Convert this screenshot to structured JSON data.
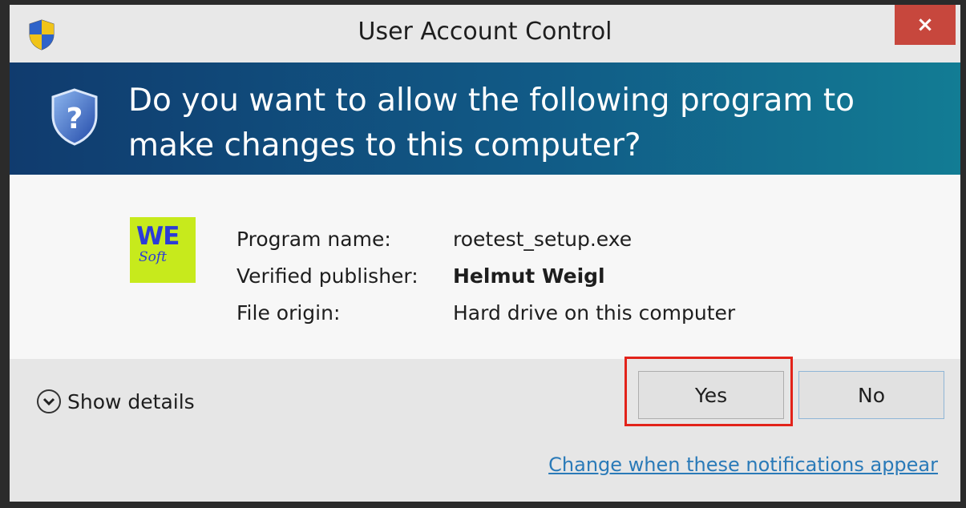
{
  "window": {
    "title": "User Account Control",
    "close_label": "×"
  },
  "banner": {
    "question": "Do you want to allow the following program to make changes to this computer?"
  },
  "app": {
    "logo_top": "WE",
    "logo_bottom": "Soft"
  },
  "info": {
    "rows": [
      {
        "label": "Program name:",
        "value": "roetest_setup.exe",
        "bold": false
      },
      {
        "label": "Verified publisher:",
        "value": "Helmut Weigl",
        "bold": true
      },
      {
        "label": "File origin:",
        "value": "Hard drive on this computer",
        "bold": false
      }
    ]
  },
  "footer": {
    "show_details_label": "Show details",
    "yes_label": "Yes",
    "no_label": "No",
    "change_link": "Change when these notifications appear"
  },
  "colors": {
    "banner_start": "#103b6e",
    "banner_end": "#127c94",
    "close_button": "#c7473d",
    "highlight": "#e2231a",
    "link": "#2a7ab8",
    "logo_bg": "#c7ea1c"
  },
  "icons": {
    "title": "uac-shield-icon",
    "banner": "question-shield-icon",
    "details": "chevron-down-circle-icon"
  }
}
